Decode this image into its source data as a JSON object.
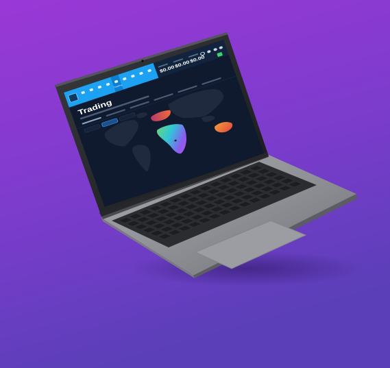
{
  "colors": {
    "background_top": "#9a38d6",
    "background_bottom": "#5a3fb8",
    "laptop_body": "#8f9196",
    "laptop_body_dark": "#6e7075",
    "keyboard_well": "#2b2c30",
    "key": "#1c1d20",
    "screen_bg": "#0f1a2e",
    "nav_bar": "#1da1f2",
    "map_land": "#1f2a3f",
    "region_europe": "#e8483a",
    "region_africa_start": "#6cd37a",
    "region_africa_mid": "#8a5cf0",
    "region_australia": "#f0794a"
  },
  "app": {
    "nav_tabs": [
      "",
      "",
      "",
      "",
      "Trading",
      "",
      "",
      "",
      ""
    ],
    "stats": [
      {
        "label": "",
        "value": "$0.00"
      },
      {
        "label": "",
        "value": "$0.00"
      },
      {
        "label": "",
        "value": "$0.00"
      }
    ],
    "page_title": "Trading",
    "page_subtitle": "",
    "sub_tabs": [
      "",
      "",
      "",
      "",
      "",
      ""
    ],
    "filters": [
      "",
      "",
      ""
    ],
    "active_filter_index": 1
  },
  "icons": {
    "logo": "app-logo-icon",
    "search": "search-icon",
    "notifications": "bell-icon",
    "user": "user-icon",
    "settings": "gear-icon"
  }
}
